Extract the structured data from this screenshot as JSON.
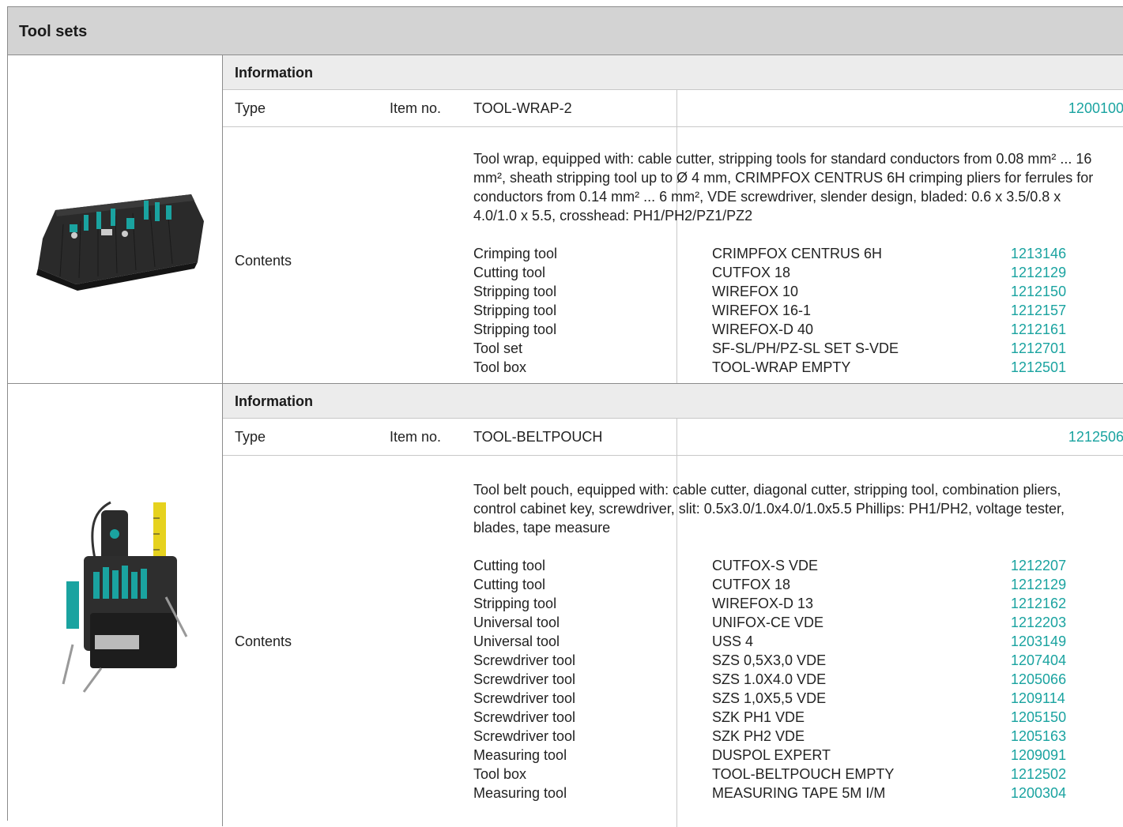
{
  "title": "Tool sets",
  "products": [
    {
      "info_header": "Information",
      "type_label": "Type",
      "item_no_label": "Item no.",
      "type": "TOOL-WRAP-2",
      "item_no": "1200100",
      "contents_label": "Contents",
      "description": "Tool wrap, equipped with: cable cutter, stripping tools for standard conductors from 0.08 mm² ... 16 mm², sheath stripping tool up to Ø 4 mm, CRIMPFOX CENTRUS 6H crimping pliers for ferrules for conductors from 0.14 mm² ... 6 mm², VDE screwdriver, slender design, bladed: 0.6 x 3.5/0.8 x 4.0/1.0 x 5.5, crosshead: PH1/PH2/PZ1/PZ2",
      "components": [
        {
          "category": "Crimping tool",
          "name": "CRIMPFOX CENTRUS 6H",
          "item_no": "1213146"
        },
        {
          "category": "Cutting tool",
          "name": "CUTFOX 18",
          "item_no": "1212129"
        },
        {
          "category": "Stripping tool",
          "name": "WIREFOX 10",
          "item_no": "1212150"
        },
        {
          "category": "Stripping tool",
          "name": "WIREFOX 16-1",
          "item_no": "1212157"
        },
        {
          "category": "Stripping tool",
          "name": "WIREFOX-D 40",
          "item_no": "1212161"
        },
        {
          "category": "Tool set",
          "name": "SF-SL/PH/PZ-SL SET S-VDE",
          "item_no": "1212701"
        },
        {
          "category": "Tool box",
          "name": "TOOL-WRAP EMPTY",
          "item_no": "1212501"
        }
      ]
    },
    {
      "info_header": "Information",
      "type_label": "Type",
      "item_no_label": "Item no.",
      "type": "TOOL-BELTPOUCH",
      "item_no": "1212506",
      "contents_label": "Contents",
      "description": "Tool belt pouch, equipped with: cable cutter, diagonal cutter, stripping tool, combination pliers, control cabinet key, screwdriver, slit: 0.5x3.0/1.0x4.0/1.0x5.5 Phillips: PH1/PH2, voltage tester, blades, tape measure",
      "components": [
        {
          "category": "Cutting tool",
          "name": "CUTFOX-S VDE",
          "item_no": "1212207"
        },
        {
          "category": "Cutting tool",
          "name": "CUTFOX 18",
          "item_no": "1212129"
        },
        {
          "category": "Stripping tool",
          "name": "WIREFOX-D 13",
          "item_no": "1212162"
        },
        {
          "category": "Universal tool",
          "name": "UNIFOX-CE VDE",
          "item_no": "1212203"
        },
        {
          "category": "Universal tool",
          "name": "USS 4",
          "item_no": "1203149"
        },
        {
          "category": "Screwdriver tool",
          "name": "SZS 0,5X3,0 VDE",
          "item_no": "1207404"
        },
        {
          "category": "Screwdriver tool",
          "name": "SZS 1.0X4.0 VDE",
          "item_no": "1205066"
        },
        {
          "category": "Screwdriver tool",
          "name": "SZS 1,0X5,5 VDE",
          "item_no": "1209114"
        },
        {
          "category": "Screwdriver tool",
          "name": "SZK PH1 VDE",
          "item_no": "1205150"
        },
        {
          "category": "Screwdriver tool",
          "name": "SZK PH2 VDE",
          "item_no": "1205163"
        },
        {
          "category": "Measuring tool",
          "name": "DUSPOL EXPERT",
          "item_no": "1209091"
        },
        {
          "category": "Tool box",
          "name": "TOOL-BELTPOUCH EMPTY",
          "item_no": "1212502"
        },
        {
          "category": "Measuring tool",
          "name": "MEASURING TAPE 5M I/M",
          "item_no": "1200304"
        }
      ]
    }
  ],
  "colors": {
    "accent": "#1aa3a0",
    "header_bg": "#d3d3d3",
    "info_bg": "#ececec"
  }
}
